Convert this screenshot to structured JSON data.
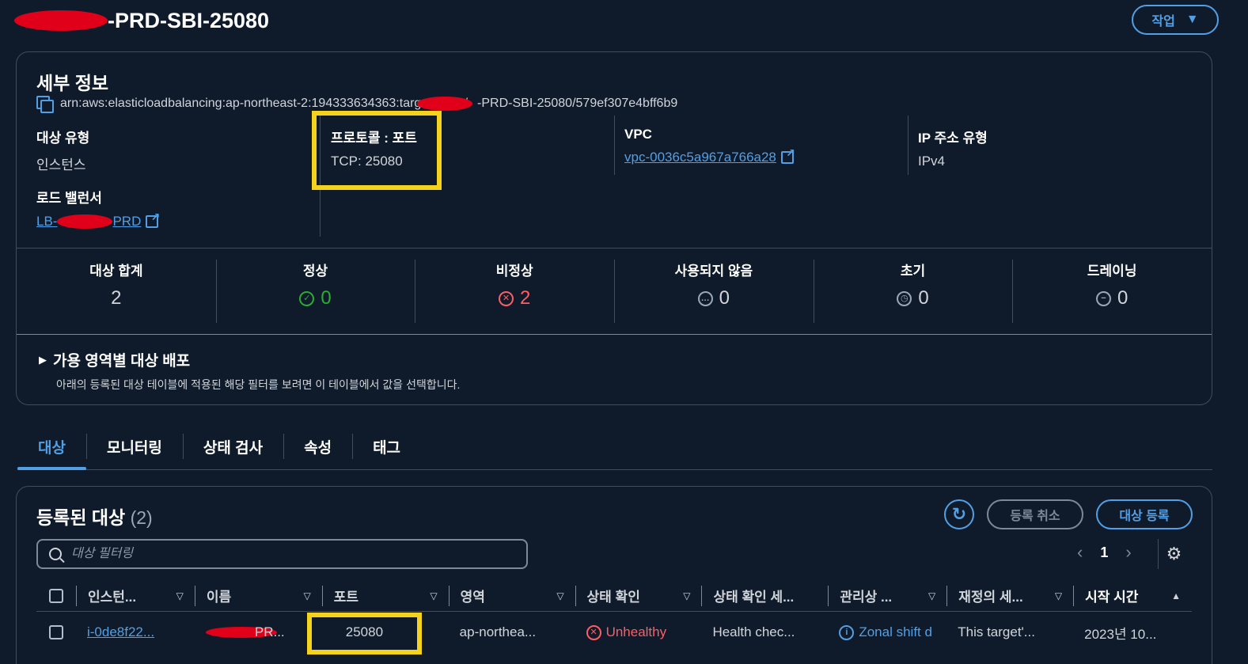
{
  "header": {
    "title_suffix": "-PRD-SBI-25080",
    "actions_label": "작업"
  },
  "details": {
    "title": "세부 정보",
    "arn_prefix": "arn:aws:elasticloadbalancing:ap-northeast-2:194333634363:targetgroup/",
    "arn_suffix": "-PRD-SBI-25080/579ef307e4bff6b9",
    "target_type": {
      "label": "대상 유형",
      "value": "인스턴스"
    },
    "protocol_port": {
      "label": "프로토콜 : 포트",
      "value": "TCP: 25080"
    },
    "vpc": {
      "label": "VPC",
      "value": "vpc-0036c5a967a766a28"
    },
    "ip_type": {
      "label": "IP 주소 유형",
      "value": "IPv4"
    },
    "load_balancer": {
      "label": "로드 밸런서",
      "value_prefix": "LB-",
      "value_suffix": "PRD"
    }
  },
  "stats": [
    {
      "label": "대상 합계",
      "value": "2",
      "icon": "none",
      "color": "#d1d5db"
    },
    {
      "label": "정상",
      "value": "0",
      "icon": "check-circle-icon",
      "color": "#29ad32"
    },
    {
      "label": "비정상",
      "value": "2",
      "icon": "x-circle-icon",
      "color": "#ff5d64"
    },
    {
      "label": "사용되지 않음",
      "value": "0",
      "icon": "ellipsis-circle-icon",
      "color": "#9ba7b6"
    },
    {
      "label": "초기",
      "value": "0",
      "icon": "clock-icon",
      "color": "#9ba7b6"
    },
    {
      "label": "드레이닝",
      "value": "0",
      "icon": "minus-circle-icon",
      "color": "#9ba7b6"
    }
  ],
  "az": {
    "title": "가용 영역별 대상 배포",
    "desc": "아래의 등록된 대상 테이블에 적용된 해당 필터를 보려면 이 테이블에서 값을 선택합니다."
  },
  "tabs": [
    "대상",
    "모니터링",
    "상태 검사",
    "속성",
    "태그"
  ],
  "targets": {
    "title": "등록된 대상",
    "count": "(2)",
    "deregister_label": "등록 취소",
    "register_label": "대상 등록",
    "search_placeholder": "대상 필터링",
    "page": "1",
    "columns": [
      "인스턴...",
      "이름",
      "포트",
      "영역",
      "상태 확인",
      "상태 확인 세...",
      "관리상 ...",
      "재정의 세...",
      "시작 시간"
    ],
    "row": {
      "instance": "i-0de8f22...",
      "name": "PR...",
      "port": "25080",
      "zone": "ap-northea...",
      "health": "Unhealthy",
      "health_detail": "Health chec...",
      "admin": "Zonal shift d",
      "override": "This target'...",
      "start": "2023년 10..."
    }
  },
  "colors": {
    "accent": "#539fe5",
    "highlight": "#f5d21c",
    "redaction": "#e0001a"
  }
}
